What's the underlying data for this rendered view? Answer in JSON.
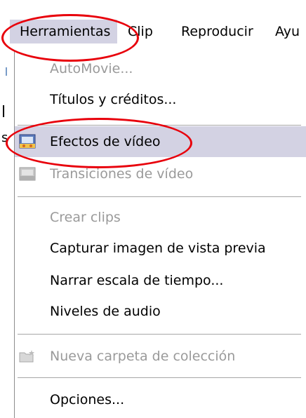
{
  "menubar": {
    "items": [
      {
        "label": "Herramientas"
      },
      {
        "label": "Clip"
      },
      {
        "label": "Reproducir"
      },
      {
        "label": "Ayu"
      }
    ]
  },
  "menu": {
    "items": [
      {
        "label": "AutoMovie...",
        "enabled": false
      },
      {
        "label": "Títulos y créditos...",
        "enabled": true
      },
      {
        "label": "Efectos de vídeo",
        "enabled": true,
        "highlighted": true,
        "icon": "video-effects-icon"
      },
      {
        "label": "Transiciones de vídeo",
        "enabled": false,
        "icon": "video-transitions-icon"
      },
      {
        "label": "Crear clips",
        "enabled": false
      },
      {
        "label": "Capturar imagen de vista previa",
        "enabled": true
      },
      {
        "label": "Narrar escala de tiempo...",
        "enabled": true
      },
      {
        "label": "Niveles de audio",
        "enabled": true
      },
      {
        "label": "Nueva carpeta de colección",
        "enabled": false,
        "icon": "new-folder-icon"
      },
      {
        "label": "Opciones...",
        "enabled": true
      }
    ]
  },
  "background": {
    "glyph_upper": "l",
    "glyph_lower": "s"
  },
  "colors": {
    "highlight": "#d3d2e3",
    "annotation": "#e8000b",
    "disabled_text": "#9a9a9a"
  }
}
